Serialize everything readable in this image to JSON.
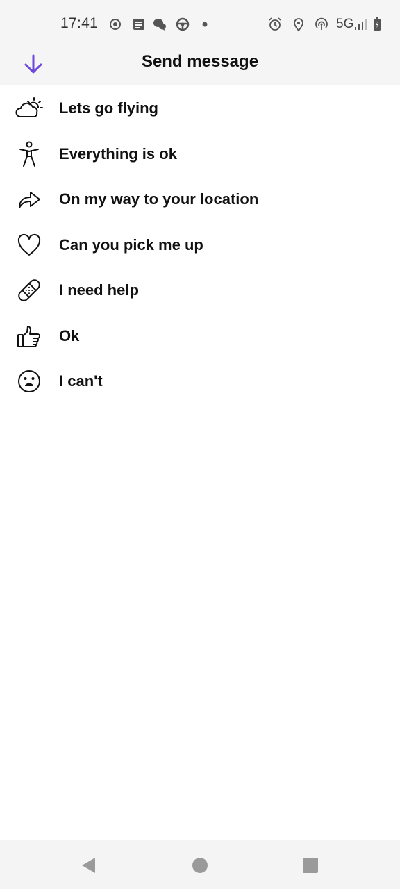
{
  "status_bar": {
    "time": "17:41",
    "network": "5G",
    "left_icons": [
      "record-icon",
      "note-icon",
      "chat-icon",
      "steering-icon",
      "dot-icon"
    ],
    "right_icons": [
      "alarm-icon",
      "location-pin-icon",
      "hotspot-icon",
      "signal-icon",
      "battery-icon"
    ]
  },
  "header": {
    "title": "Send message",
    "back_icon": "arrow-down-icon",
    "accent_color": "#6c47d9"
  },
  "messages": [
    {
      "label": "Lets go flying",
      "icon": "cloud-sun-icon"
    },
    {
      "label": "Everything is ok",
      "icon": "accessibility-person-icon"
    },
    {
      "label": "On my way to your location",
      "icon": "share-arrow-icon"
    },
    {
      "label": "Can you pick me up",
      "icon": "heart-icon"
    },
    {
      "label": "I need help",
      "icon": "bandage-icon"
    },
    {
      "label": "Ok",
      "icon": "thumbs-up-icon"
    },
    {
      "label": "I can't",
      "icon": "sad-face-icon"
    }
  ],
  "nav_bar": {
    "back_icon": "nav-back-icon",
    "home_icon": "nav-home-icon",
    "recents_icon": "nav-recents-icon"
  }
}
